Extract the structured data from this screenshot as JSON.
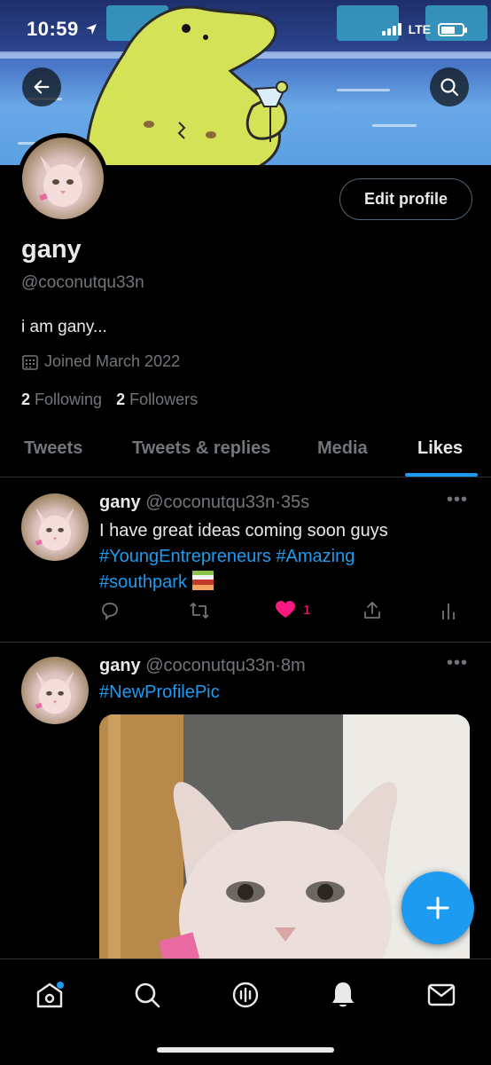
{
  "status_bar": {
    "time": "10:59",
    "network": "LTE"
  },
  "profile": {
    "name": "gany",
    "handle": "@coconutqu33n",
    "bio": "i am gany...",
    "joined": "Joined March 2022",
    "following_count": "2",
    "following_label": "Following",
    "followers_count": "2",
    "followers_label": "Followers",
    "edit_label": "Edit profile"
  },
  "tabs": [
    {
      "label": "Tweets"
    },
    {
      "label": "Tweets & replies"
    },
    {
      "label": "Media"
    },
    {
      "label": "Likes",
      "active": true
    }
  ],
  "tweets": [
    {
      "name": "gany",
      "handle": "@coconutqu33n",
      "time": "35s",
      "text": "I have great ideas coming soon guys",
      "tags": [
        "#YoungEntrepreneurs",
        "#Amazing",
        "#southpark"
      ],
      "likes": "1",
      "liked": true
    },
    {
      "name": "gany",
      "handle": "@coconutqu33n",
      "time": "8m",
      "tags": [
        "#NewProfilePic"
      ]
    }
  ],
  "icons": {
    "back": "back-arrow-icon",
    "search": "search-icon",
    "calendar": "calendar-icon",
    "reply": "reply-icon",
    "retweet": "retweet-icon",
    "like": "heart-icon",
    "share": "share-icon",
    "analytics": "analytics-icon",
    "compose": "plus-icon"
  },
  "colors": {
    "accent": "#1d9bf0",
    "like": "#f91880",
    "background": "#000000"
  }
}
